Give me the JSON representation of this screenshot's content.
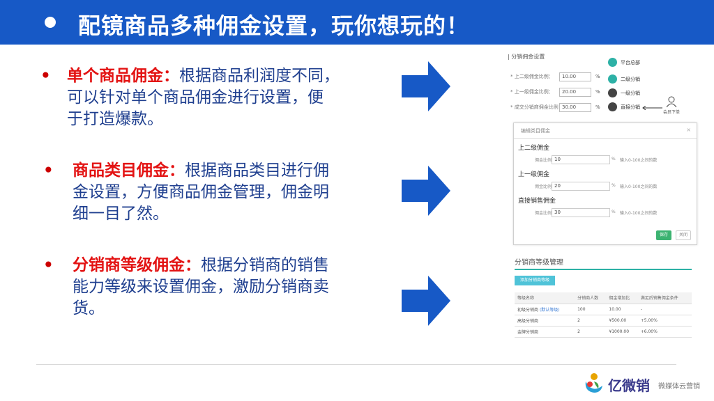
{
  "header": {
    "title": "配镜商品多种佣金设置，玩你想玩的！"
  },
  "bullets": [
    {
      "marker": "•",
      "highlight": "单个商品佣金：",
      "line1": "根据商品利润度不同，",
      "line2": "可以针对单个商品佣金进行设置，便",
      "line3": "于打造爆款。"
    },
    {
      "marker": "•",
      "highlight": "商品类目佣金：",
      "line1": "根据商品类目进行佣",
      "line2": "金设置，方便商品佣金管理，佣金明",
      "line3": "细一目了然。"
    },
    {
      "marker": "•",
      "highlight": "分销商等级佣金：",
      "line1": "根据分销商的销售",
      "line2": "能力等级来设置佣金，激励分销商卖",
      "line3": "货。"
    }
  ],
  "thumb_single": {
    "title": "| 分销佣金设置",
    "rows": [
      {
        "label": "* 上二级佣金比例：",
        "value": "10.00",
        "unit": "%"
      },
      {
        "label": "* 上一级佣金比例：",
        "value": "20.00",
        "unit": "%"
      },
      {
        "label": "* 成交分销商佣金比例：",
        "value": "30.00",
        "unit": "%"
      }
    ],
    "nodes": [
      "平台总部",
      "二级分销",
      "一级分销",
      "直接分销"
    ],
    "buyer": "会员下单"
  },
  "thumb_category": {
    "title": "编辑类目佣金",
    "close": "×",
    "sections": [
      {
        "name": "上二级佣金",
        "label": "佣金比例",
        "value": "10",
        "unit": "%",
        "hint": "输入0-100之间的数"
      },
      {
        "name": "上一级佣金",
        "label": "佣金比例",
        "value": "20",
        "unit": "%",
        "hint": "输入0-100之间的数"
      },
      {
        "name": "直接销售佣金",
        "label": "佣金比例",
        "value": "30",
        "unit": "%",
        "hint": "输入0-100之间的数"
      }
    ],
    "save": "保存",
    "cancel": "关闭"
  },
  "thumb_level": {
    "title": "分销商等级管理",
    "add_button": "添加分销商等级",
    "columns": [
      "等级名称",
      "分销商人数",
      "佣金增加比",
      "满足后销售佣金条件"
    ],
    "rows": [
      {
        "name": "初级分销商",
        "tag": "(默认等级)",
        "count": "100",
        "ratio": "10.00",
        "cond": "-"
      },
      {
        "name": "高级分销商",
        "tag": "",
        "count": "2",
        "ratio": "¥500.00",
        "cond": "+5.00%"
      },
      {
        "name": "金牌分销商",
        "tag": "",
        "count": "2",
        "ratio": "¥1000.00",
        "cond": "+6.00%"
      }
    ]
  },
  "footer": {
    "brand": "亿微销",
    "slogan": "微媒体云营销"
  },
  "colors": {
    "header": "#1759c6",
    "highlight": "#e31313",
    "text": "#1f3f8f",
    "arrow": "#1759c6"
  }
}
